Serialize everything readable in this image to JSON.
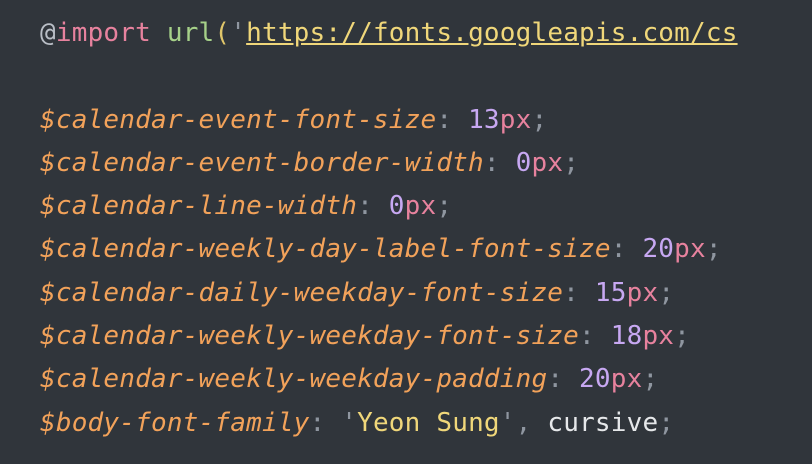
{
  "colors": {
    "background": "#30353b",
    "variable": "#f2a25a",
    "keyword": "#e7829e",
    "number": "#c7a8f2",
    "string": "#f0d77a",
    "function": "#a6d189",
    "punctuation": "#8f96a0"
  },
  "code": {
    "import_line": {
      "at": "@",
      "keyword": "import",
      "space": " ",
      "func": "url",
      "open_paren": "(",
      "quote": "'",
      "url_text": "https://fonts.googleapis.com/cs"
    },
    "declarations": [
      {
        "name": "$calendar-event-font-size",
        "colon": ": ",
        "value": "13",
        "unit": "px",
        "semi": ";"
      },
      {
        "name": "$calendar-event-border-width",
        "colon": ": ",
        "value": "0",
        "unit": "px",
        "semi": ";"
      },
      {
        "name": "$calendar-line-width",
        "colon": ": ",
        "value": "0",
        "unit": "px",
        "semi": ";"
      },
      {
        "name": "$calendar-weekly-day-label-font-size",
        "colon": ": ",
        "value": "20",
        "unit": "px",
        "semi": ";"
      },
      {
        "name": "$calendar-daily-weekday-font-size",
        "colon": ": ",
        "value": "15",
        "unit": "px",
        "semi": ";"
      },
      {
        "name": "$calendar-weekly-weekday-font-size",
        "colon": ": ",
        "value": "18",
        "unit": "px",
        "semi": ";"
      },
      {
        "name": "$calendar-weekly-weekday-padding",
        "colon": ": ",
        "value": "20",
        "unit": "px",
        "semi": ";"
      }
    ],
    "font_family_line": {
      "name": "$body-font-family",
      "colon": ": ",
      "quote_open": "'",
      "string": "Yeon Sung",
      "quote_close": "'",
      "comma": ", ",
      "ident": "cursive",
      "semi": ";"
    }
  }
}
